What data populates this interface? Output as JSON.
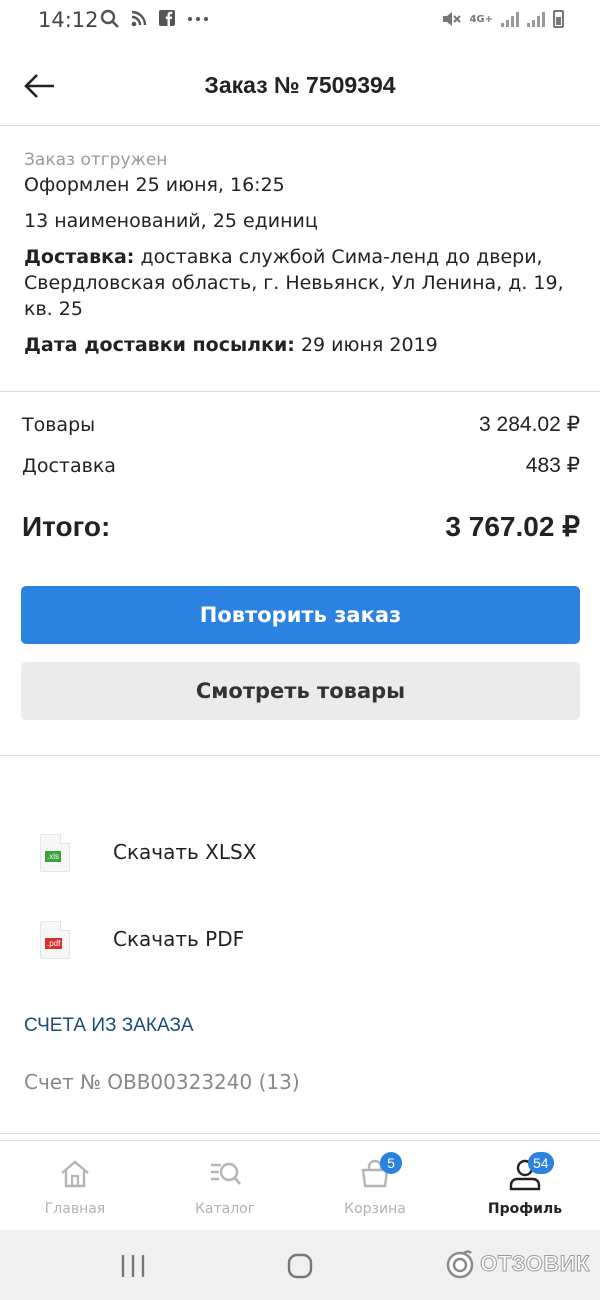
{
  "status_bar": {
    "time": "14:12",
    "network": "4G+"
  },
  "header": {
    "title": "Заказ № 7509394"
  },
  "order": {
    "status": "Заказ отгружен",
    "created": "Оформлен 25 июня, 16:25",
    "items_count": "13 наименований, 25 единиц",
    "delivery_label": "Доставка:",
    "delivery_value": "доставка службой Сима-ленд до двери, Свердловская область, г. Невьянск, Ул Ленина, д. 19, кв. 25",
    "delivery_date_label": "Дата доставки посылки:",
    "delivery_date_value": "29 июня 2019"
  },
  "totals": {
    "goods_label": "Товары",
    "goods_value": "3 284.02 ₽",
    "delivery_label": "Доставка",
    "delivery_value": "483 ₽",
    "total_label": "Итого:",
    "total_value": "3 767.02 ₽"
  },
  "actions": {
    "repeat_label": "Повторить заказ",
    "view_label": "Смотреть товары"
  },
  "downloads": [
    {
      "label": "Скачать XLSX",
      "ext": ".xls",
      "color": "#3aa23a"
    },
    {
      "label": "Скачать PDF",
      "ext": ".pdf",
      "color": "#d8312b"
    }
  ],
  "invoices": {
    "title": "СЧЕТА ИЗ ЗАКАЗА",
    "item": "Счет № OBB00323240 (13)"
  },
  "bottom_nav": [
    {
      "label": "Главная",
      "icon": "home-icon",
      "active": false
    },
    {
      "label": "Каталог",
      "icon": "catalog-search-icon",
      "active": false
    },
    {
      "label": "Корзина",
      "icon": "basket-icon",
      "badge": "5",
      "active": false
    },
    {
      "label": "Профиль",
      "icon": "profile-icon",
      "badge": "54",
      "active": true
    }
  ],
  "watermark": "ОТЗОВИК",
  "colors": {
    "accent": "#2c82e0",
    "secondary_button": "#ebebeb",
    "section_title": "#1c4a7a"
  }
}
